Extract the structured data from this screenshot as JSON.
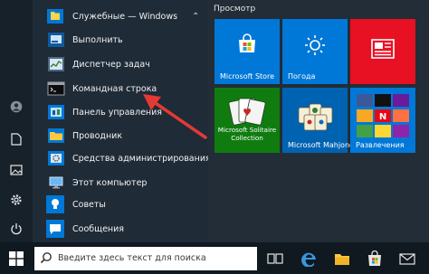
{
  "folder": {
    "label": "Служебные — Windows",
    "icon": "folder-icon"
  },
  "apps": [
    {
      "label": "Выполнить",
      "icon": "run-icon"
    },
    {
      "label": "Диспетчер задач",
      "icon": "task-manager-icon"
    },
    {
      "label": "Командная строка",
      "icon": "command-prompt-icon"
    },
    {
      "label": "Панель управления",
      "icon": "control-panel-icon"
    },
    {
      "label": "Проводник",
      "icon": "file-explorer-icon"
    },
    {
      "label": "Средства администрирования Wi...",
      "icon": "admin-tools-icon"
    },
    {
      "label": "Этот компьютер",
      "icon": "this-pc-icon"
    },
    {
      "label": "Советы",
      "icon": "tips-icon"
    },
    {
      "label": "Сообщения",
      "icon": "messages-icon"
    }
  ],
  "tiles": {
    "group_label": "Просмотр",
    "items": [
      {
        "label": "Microsoft Store",
        "color": "#0078d7",
        "icon": "store-icon"
      },
      {
        "label": "Погода",
        "color": "#0078d7",
        "icon": "weather-icon"
      },
      {
        "label": "",
        "color": "#e81123",
        "icon": "news-icon"
      },
      {
        "label": "Microsoft Solitaire Collection",
        "color": "#107c10",
        "icon": "solitaire-icon"
      },
      {
        "label": "Microsoft Mahjong",
        "color": "#0063b1",
        "icon": "mahjong-icon"
      },
      {
        "label": "Развлечения",
        "color": "#0078d7",
        "icon": "entertainment-icon"
      }
    ]
  },
  "taskbar": {
    "search_placeholder": "Введите здесь текст для поиска"
  },
  "colors": {
    "accent": "#0078d7",
    "arrow": "#e53935"
  }
}
